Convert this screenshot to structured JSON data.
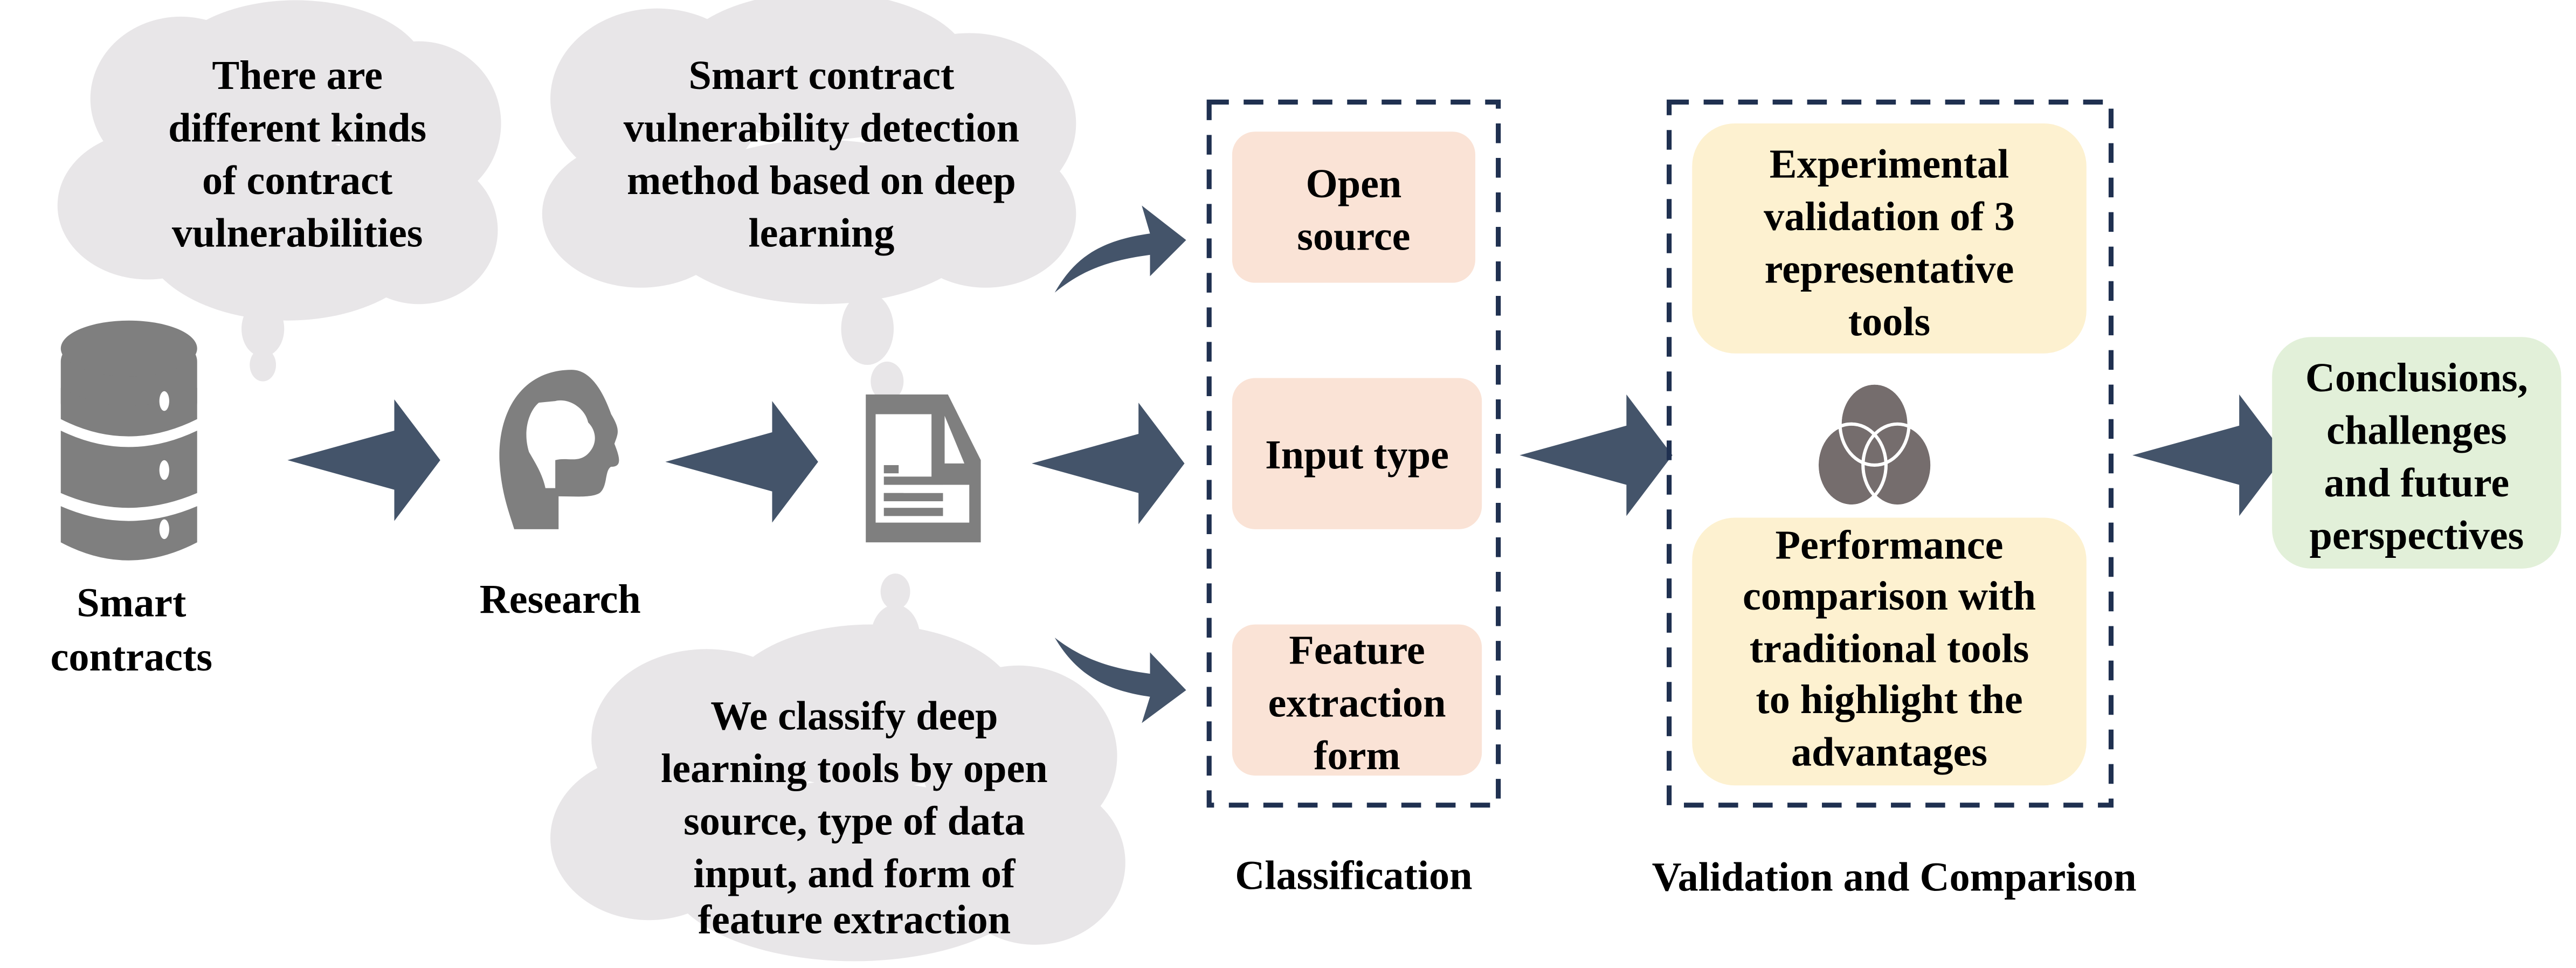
{
  "colors": {
    "cloud": "#e8e6e8",
    "icon_gray": "#7f7f7f",
    "arrow": "#44546a",
    "dashed_border": "#1f3050",
    "classification_box": "#fae3d6",
    "validation_box": "#fdf1d0",
    "conclusion_box": "#e2f0d9",
    "venn": "#756d6d"
  },
  "clouds": [
    {
      "lines": [
        "There are",
        "different kinds",
        "of contract",
        "vulnerabilities"
      ]
    },
    {
      "lines": [
        "Smart contract",
        "vulnerability detection",
        "method based on deep",
        "learning"
      ]
    },
    {
      "lines": [
        "We classify deep",
        "learning tools by open",
        "source, type of data",
        "input, and form of",
        "feature extraction"
      ]
    }
  ],
  "icons": {
    "database": "database-icon",
    "research": "head-brain-icon",
    "document": "document-icon",
    "venn": "venn-diagram-icon"
  },
  "labels": {
    "smart_contracts": [
      "Smart",
      "contracts"
    ],
    "research": "Research",
    "classification": "Classification",
    "validation": "Validation and Comparison"
  },
  "classification_boxes": [
    {
      "lines": [
        "Open",
        "source"
      ]
    },
    {
      "lines": [
        "Input type"
      ]
    },
    {
      "lines": [
        "Feature",
        "extraction",
        "form"
      ]
    }
  ],
  "validation_boxes": [
    {
      "lines": [
        "Experimental",
        "validation of 3",
        "representative",
        "tools"
      ]
    },
    {
      "lines": [
        "Performance",
        "comparison with",
        "traditional tools",
        "to highlight the",
        "advantages"
      ]
    }
  ],
  "conclusion": {
    "lines": [
      "Conclusions,",
      "challenges",
      "and future",
      "perspectives"
    ]
  }
}
